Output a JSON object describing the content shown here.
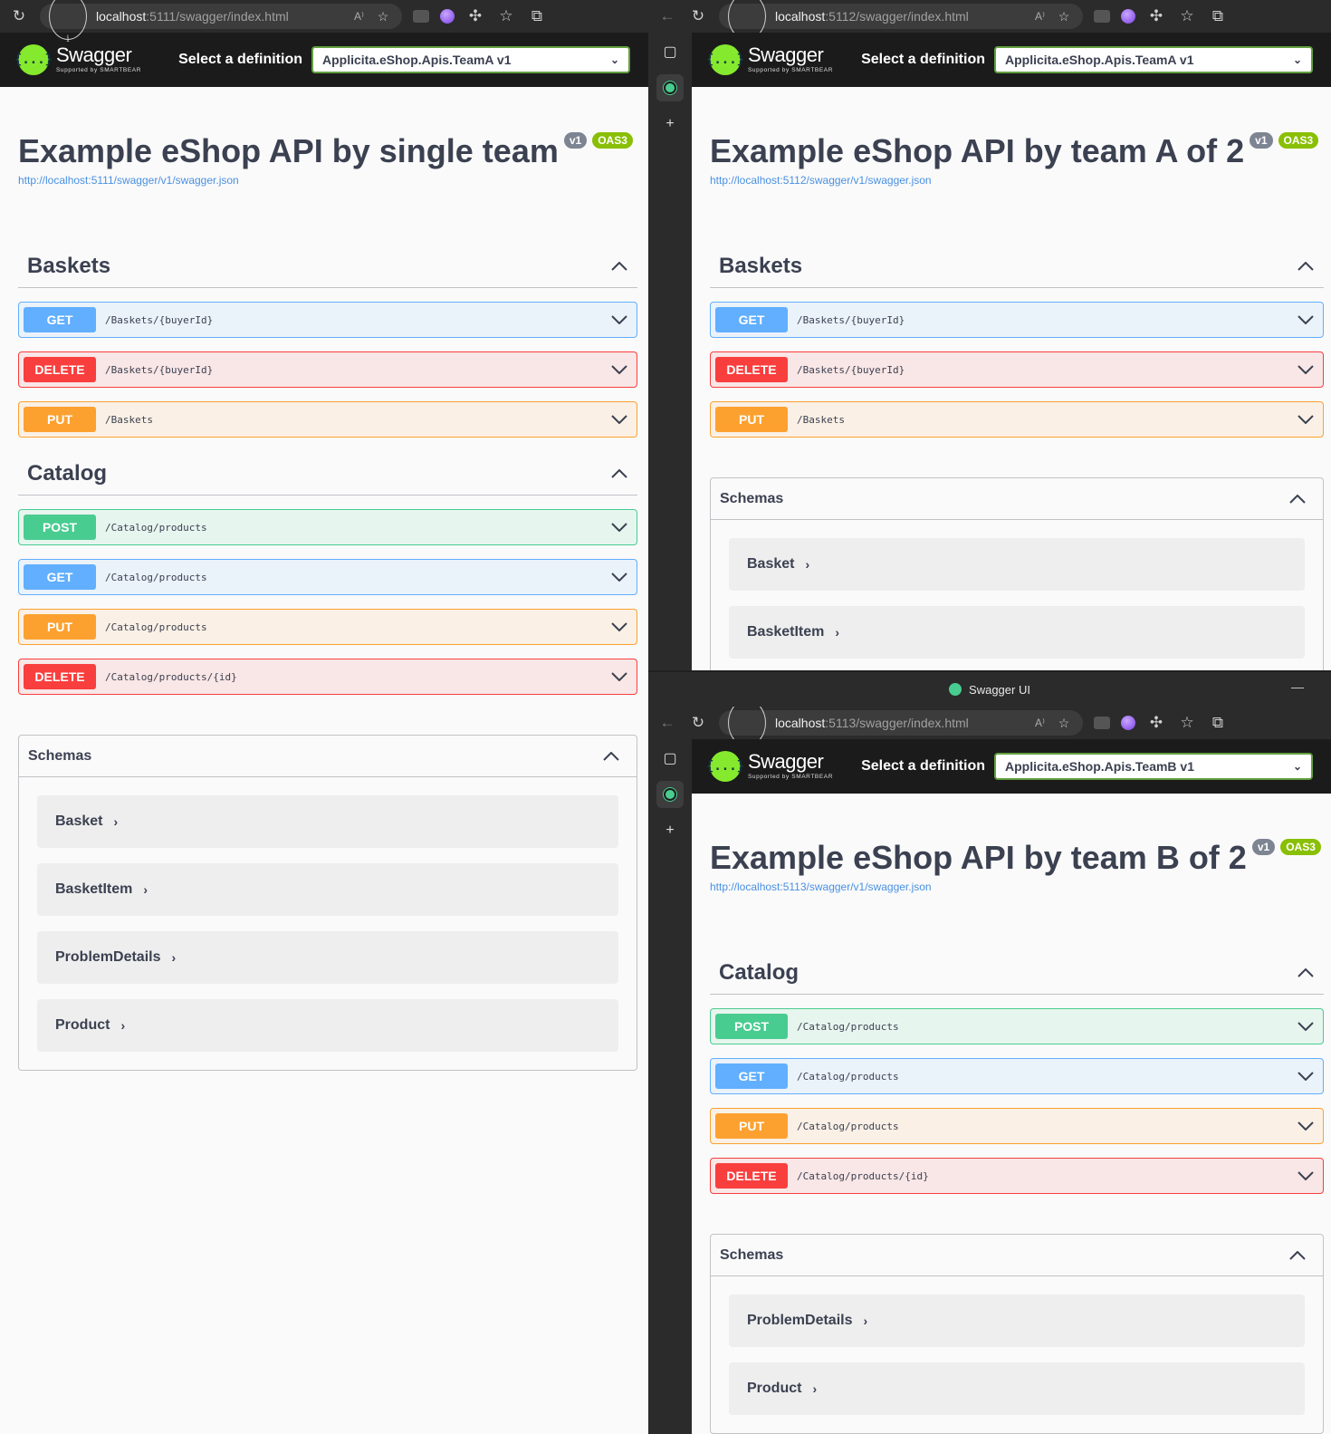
{
  "windows": [
    {
      "url_host": "localhost",
      "url_rest": ":5111/swagger/index.html",
      "selector_label": "Select a definition",
      "selected_definition": "Applicita.eShop.Apis.TeamA v1",
      "title": "Example eShop API by single team",
      "version_badge": "v1",
      "oas_badge": "OAS3",
      "spec_link": "http://localhost:5111/swagger/v1/swagger.json",
      "tags": [
        {
          "name": "Baskets",
          "ops": [
            {
              "method": "GET",
              "path": "/Baskets/{buyerId}"
            },
            {
              "method": "DELETE",
              "path": "/Baskets/{buyerId}"
            },
            {
              "method": "PUT",
              "path": "/Baskets"
            }
          ]
        },
        {
          "name": "Catalog",
          "ops": [
            {
              "method": "POST",
              "path": "/Catalog/products"
            },
            {
              "method": "GET",
              "path": "/Catalog/products"
            },
            {
              "method": "PUT",
              "path": "/Catalog/products"
            },
            {
              "method": "DELETE",
              "path": "/Catalog/products/{id}"
            }
          ]
        }
      ],
      "schemas_title": "Schemas",
      "schemas": [
        "Basket",
        "BasketItem",
        "ProblemDetails",
        "Product"
      ]
    },
    {
      "url_host": "localhost",
      "url_rest": ":5112/swagger/index.html",
      "selector_label": "Select a definition",
      "selected_definition": "Applicita.eShop.Apis.TeamA v1",
      "title": "Example eShop API by team A of 2",
      "version_badge": "v1",
      "oas_badge": "OAS3",
      "spec_link": "http://localhost:5112/swagger/v1/swagger.json",
      "tags": [
        {
          "name": "Baskets",
          "ops": [
            {
              "method": "GET",
              "path": "/Baskets/{buyerId}"
            },
            {
              "method": "DELETE",
              "path": "/Baskets/{buyerId}"
            },
            {
              "method": "PUT",
              "path": "/Baskets"
            }
          ]
        }
      ],
      "schemas_title": "Schemas",
      "schemas": [
        "Basket",
        "BasketItem"
      ]
    },
    {
      "window_title": "Swagger UI",
      "url_host": "localhost",
      "url_rest": ":5113/swagger/index.html",
      "selector_label": "Select a definition",
      "selected_definition": "Applicita.eShop.Apis.TeamB v1",
      "title": "Example eShop API by team B of 2",
      "version_badge": "v1",
      "oas_badge": "OAS3",
      "spec_link": "http://localhost:5113/swagger/v1/swagger.json",
      "tags": [
        {
          "name": "Catalog",
          "ops": [
            {
              "method": "POST",
              "path": "/Catalog/products"
            },
            {
              "method": "GET",
              "path": "/Catalog/products"
            },
            {
              "method": "PUT",
              "path": "/Catalog/products"
            },
            {
              "method": "DELETE",
              "path": "/Catalog/products/{id}"
            }
          ]
        }
      ],
      "schemas_title": "Schemas",
      "schemas": [
        "ProblemDetails",
        "Product"
      ]
    }
  ],
  "logo": {
    "name": "Swagger",
    "sub": "Supported by SMARTBEAR",
    "glyph": "{...}"
  },
  "colors": {
    "get": "#61affe",
    "delete": "#f93e3e",
    "put": "#fca130",
    "post": "#49cc90",
    "topbar": "#1b1b1b",
    "logo": "#85ea2d"
  }
}
